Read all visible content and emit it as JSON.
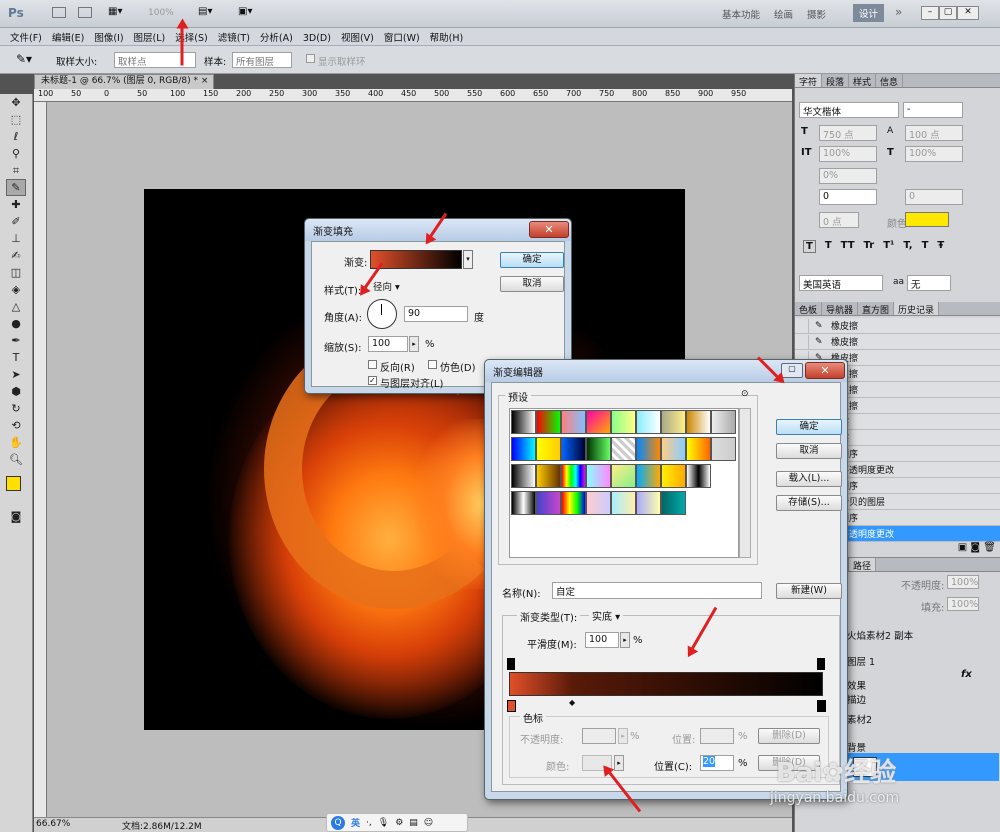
{
  "appbar": {
    "logo": "Ps",
    "zoom": "100%",
    "workspaces": [
      "基本功能",
      "绘画",
      "摄影",
      "设计"
    ],
    "active_workspace": "设计",
    "more": "»"
  },
  "menu": [
    "文件(F)",
    "编辑(E)",
    "图像(I)",
    "图层(L)",
    "选择(S)",
    "滤镜(T)",
    "分析(A)",
    "3D(D)",
    "视图(V)",
    "窗口(W)",
    "帮助(H)"
  ],
  "options": {
    "sample_size_label": "取样大小:",
    "sample_size_value": "取样点",
    "sample_label": "样本:",
    "sample_value": "所有图层",
    "show_ring_label": "显示取样环"
  },
  "document": {
    "tab": "未标题-1 @ 66.7% (图层 0, RGB/8) *",
    "ruler_h": [
      "100",
      "50",
      "0",
      "50",
      "100",
      "150",
      "200",
      "250",
      "300",
      "350",
      "400",
      "450",
      "500",
      "550",
      "600",
      "650",
      "700",
      "750",
      "800",
      "850",
      "900",
      "950"
    ],
    "zoom": "66.67%",
    "doc_size": "文档:2.86M/12.2M"
  },
  "char_panel": {
    "tabs": [
      "字符",
      "段落",
      "样式",
      "信息"
    ],
    "font": "华文楷体",
    "font_style": "-",
    "size": "750 点",
    "leading": "100 点",
    "vscale": "100%",
    "hscale": "100%",
    "baseline_pct": "0%",
    "kerning": "0",
    "tracking": "0",
    "shift": "0 点",
    "color_label": "颜色:",
    "language": "美国英语",
    "aa_label": "aa",
    "aa_value": "无",
    "style_buttons": [
      "T",
      "T",
      "TT",
      "Tr",
      "T¹",
      "T,",
      "T",
      "Ŧ"
    ]
  },
  "history_panel": {
    "tabs": [
      "色板",
      "导航器",
      "直方图",
      "历史记录"
    ],
    "items": [
      "橡皮擦",
      "橡皮擦",
      "橡皮擦",
      "橡皮擦",
      "橡皮擦",
      "橡皮擦",
      "皮擦",
      "皮擦",
      "层顺序",
      "体不透明度更改",
      "层顺序",
      "过拷贝的图层",
      "层顺序",
      "体不透明度更改"
    ]
  },
  "layers_panel": {
    "tabs": [
      "图层",
      "通道",
      "路径"
    ],
    "opacity_label": "不透明度:",
    "opacity": "100%",
    "fill_label": "填充:",
    "fill": "100%",
    "items": [
      "火焰素材2 副本",
      "图层 1",
      "效果",
      "描边",
      "素材2",
      "背景"
    ]
  },
  "gradient_fill": {
    "title": "渐变填充",
    "gradient_label": "渐变:",
    "style_label": "样式(T):",
    "style_value": "径向",
    "angle_label": "角度(A):",
    "angle_value": "90",
    "angle_unit": "度",
    "scale_label": "缩放(S):",
    "scale_value": "100",
    "scale_unit": "%",
    "reverse": "反向(R)",
    "dither": "仿色(D)",
    "align": "与图层对齐(L)",
    "ok": "确定",
    "cancel": "取消"
  },
  "gradient_editor": {
    "title": "渐变编辑器",
    "presets_label": "预设",
    "name_label": "名称(N):",
    "name_value": "自定",
    "new": "新建(W)",
    "type_label": "渐变类型(T):",
    "type_value": "实底",
    "smooth_label": "平滑度(M):",
    "smooth_value": "100",
    "smooth_unit": "%",
    "stops_label": "色标",
    "opacity_label": "不透明度:",
    "location_label": "位置:",
    "delete": "删除(D)",
    "color_label": "颜色:",
    "location_c_label": "位置(C):",
    "location_c_value": "20",
    "pct": "%",
    "ok": "确定",
    "cancel": "取消",
    "load": "载入(L)...",
    "save": "存储(S)..."
  },
  "taskbar": {
    "items": [
      "英"
    ]
  },
  "watermark": {
    "brand": "Bai",
    "suffix": "经验",
    "url": "jingyan.baidu.com"
  },
  "colors": {
    "fg": "#ffe000",
    "bg": "#e0502a",
    "grad_start": "#e0502a",
    "grad_end": "#000000",
    "font_color": "#ffe800"
  }
}
